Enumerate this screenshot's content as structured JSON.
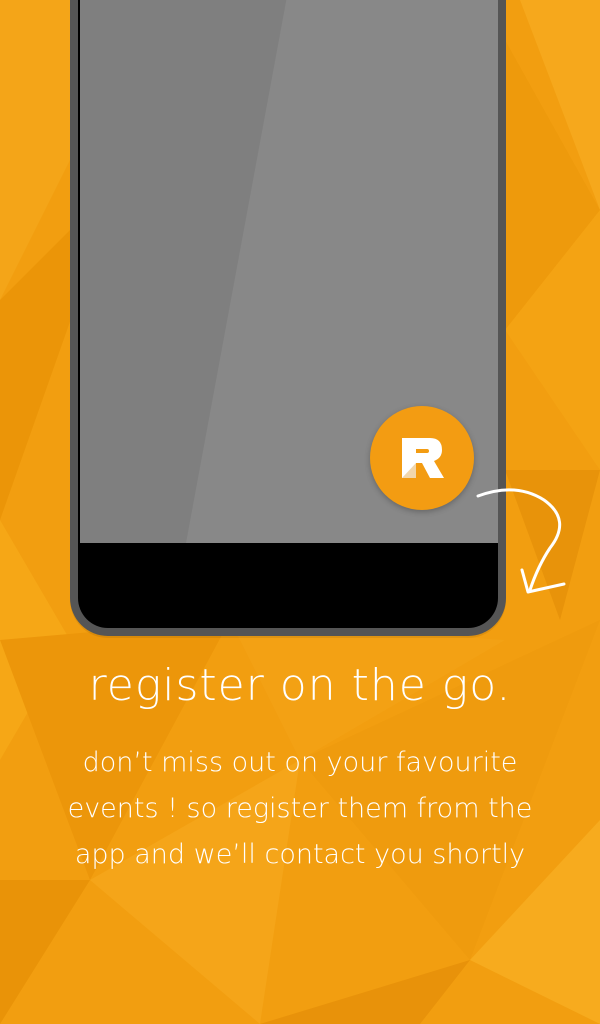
{
  "colors": {
    "background": "#f29e10",
    "accent": "#f39c12",
    "text": "#ffffff",
    "phone_frame": "#555555",
    "phone_screen": "#7f7f7f"
  },
  "app_icon": {
    "letter": "R",
    "icon": "app-logo-r-icon"
  },
  "onboarding": {
    "title": "register on the go.",
    "description_lines": [
      "don’t miss out on your favourite",
      "events ! so register them from the",
      "app and we’ll contact you shortly"
    ]
  },
  "decorations": {
    "pointer_arrow": "curved-arrow-icon"
  }
}
